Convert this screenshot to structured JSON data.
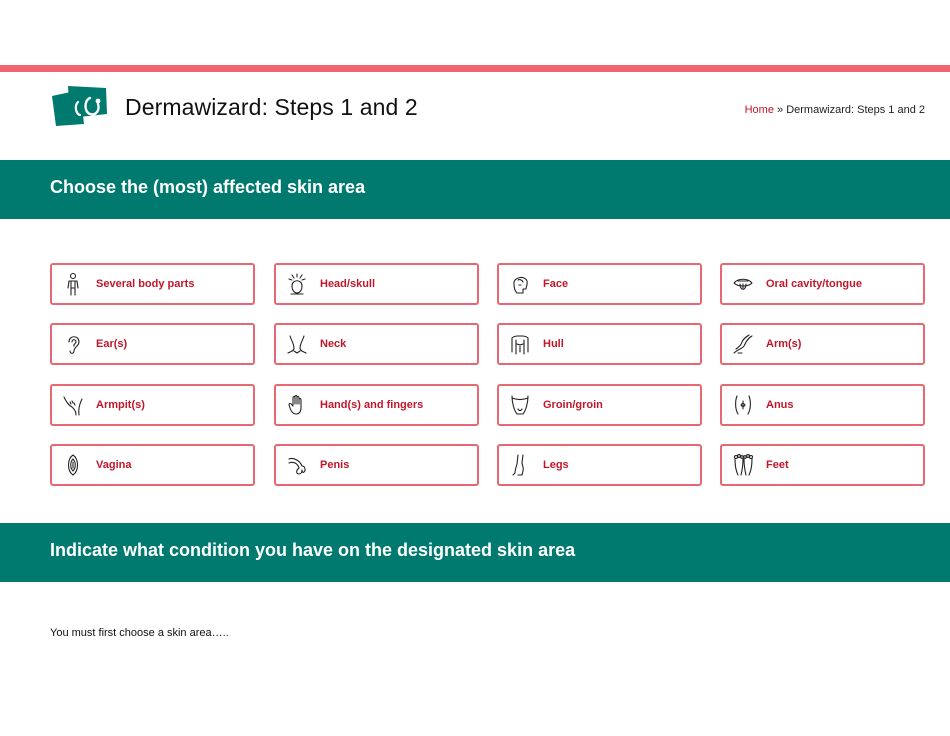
{
  "colors": {
    "accent_bar": "#f0656f",
    "teal": "#00796f",
    "button_border": "#e86872",
    "label_red": "#c0172b"
  },
  "header": {
    "title": "Dermawizard: Steps 1 and 2",
    "breadcrumb": {
      "home": "Home",
      "separator": "»",
      "current": "Dermawizard: Steps 1 and 2"
    }
  },
  "section1": {
    "heading": "Choose the (most) affected skin area"
  },
  "areas": [
    {
      "label": "Several body parts",
      "icon": "body-icon"
    },
    {
      "label": "Head/skull",
      "icon": "head-icon"
    },
    {
      "label": "Face",
      "icon": "face-icon"
    },
    {
      "label": "Oral cavity/tongue",
      "icon": "tongue-icon"
    },
    {
      "label": "Ear(s)",
      "icon": "ear-icon"
    },
    {
      "label": "Neck",
      "icon": "neck-icon"
    },
    {
      "label": "Hull",
      "icon": "torso-icon"
    },
    {
      "label": "Arm(s)",
      "icon": "arm-icon"
    },
    {
      "label": "Armpit(s)",
      "icon": "armpit-icon"
    },
    {
      "label": "Hand(s) and fingers",
      "icon": "hand-icon"
    },
    {
      "label": "Groin/groin",
      "icon": "groin-icon"
    },
    {
      "label": "Anus",
      "icon": "anus-icon"
    },
    {
      "label": "Vagina",
      "icon": "vagina-icon"
    },
    {
      "label": "Penis",
      "icon": "penis-icon"
    },
    {
      "label": "Legs",
      "icon": "legs-icon"
    },
    {
      "label": "Feet",
      "icon": "feet-icon"
    }
  ],
  "section2": {
    "heading": "Indicate what condition you have on the designated skin area",
    "note": "You must first choose a skin area….."
  }
}
